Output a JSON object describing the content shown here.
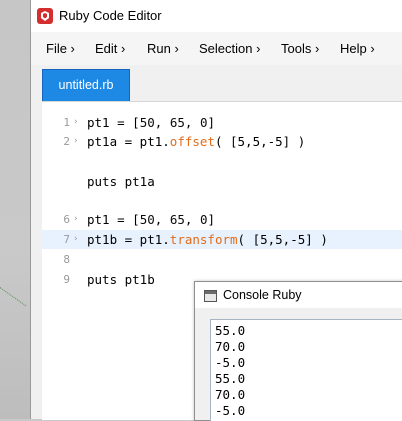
{
  "window": {
    "title": "Ruby Code Editor"
  },
  "menu": {
    "file": "File ›",
    "edit": "Edit ›",
    "run": "Run ›",
    "selection": "Selection ›",
    "tools": "Tools ›",
    "help": "Help ›"
  },
  "tab": {
    "label": "untitled.rb"
  },
  "editor": {
    "lines": [
      {
        "num": "1",
        "text": "pt1 = [50, 65, 0]"
      },
      {
        "num": "2",
        "text": "pt1a = pt1.offset( [5,5,-5] )"
      },
      {
        "num": "",
        "text": ""
      },
      {
        "num": "",
        "text": "puts pt1a"
      },
      {
        "num": "",
        "text": ""
      },
      {
        "num": "6",
        "text": "pt1 = [50, 65, 0]"
      },
      {
        "num": "7",
        "text": "pt1b = pt1.transform( [5,5,-5] )"
      },
      {
        "num": "8",
        "text": ""
      },
      {
        "num": "9",
        "text": "puts pt1b"
      }
    ]
  },
  "console": {
    "title": "Console Ruby",
    "output": [
      "55.0",
      "70.0",
      "-5.0",
      "55.0",
      "70.0",
      "-5.0"
    ]
  }
}
